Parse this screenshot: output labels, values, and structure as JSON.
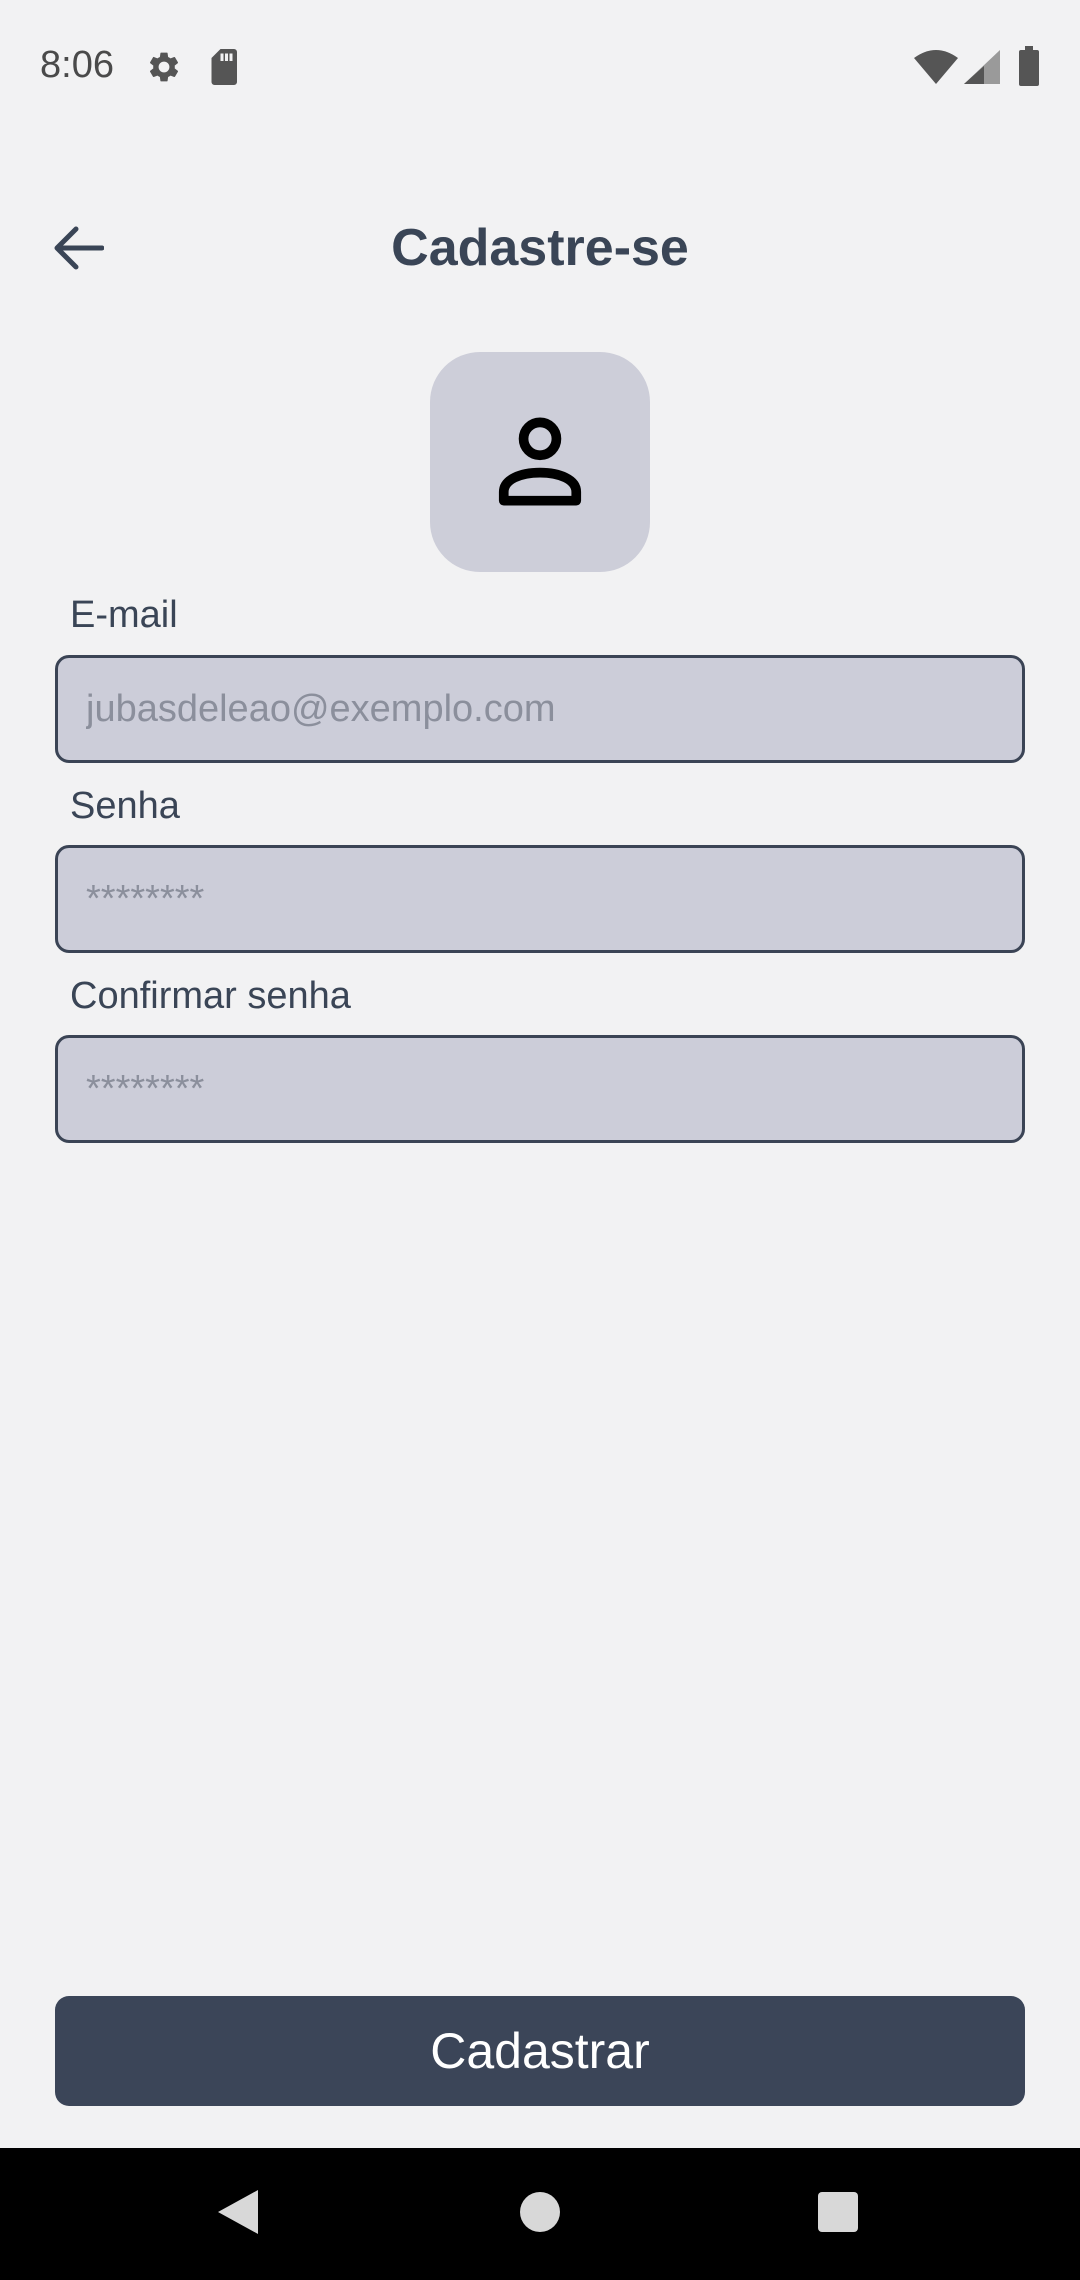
{
  "status_bar": {
    "time": "8:06",
    "icons": [
      "gear-icon",
      "sd-card-icon",
      "wifi-icon",
      "signal-icon",
      "battery-icon"
    ]
  },
  "header": {
    "title": "Cadastre-se",
    "back_icon": "arrow-back-icon"
  },
  "avatar": {
    "icon": "person-icon"
  },
  "form": {
    "email_label": "E-mail",
    "email_placeholder": "jubasdeleao@exemplo.com",
    "password_label": "Senha",
    "password_placeholder": "********",
    "confirm_label": "Confirmar senha",
    "confirm_placeholder": "********"
  },
  "submit": {
    "label": "Cadastrar"
  },
  "colors": {
    "background": "#f2f2f3",
    "primary": "#3b4558",
    "field_fill": "#cccdd9",
    "text": "#3a4556"
  }
}
